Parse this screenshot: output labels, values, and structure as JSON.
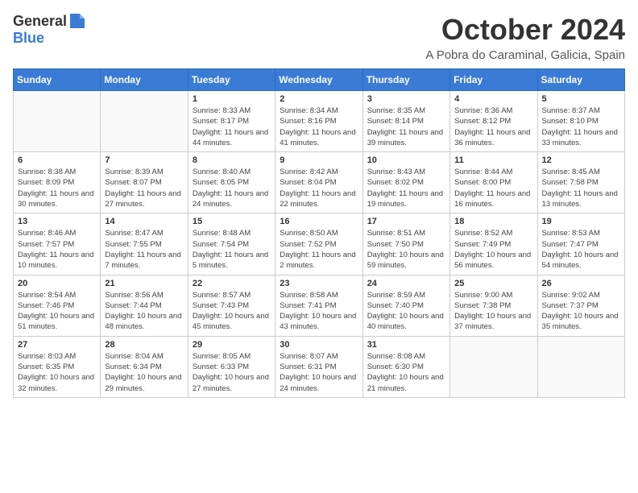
{
  "header": {
    "logo_general": "General",
    "logo_blue": "Blue",
    "title": "October 2024",
    "location": "A Pobra do Caraminal, Galicia, Spain"
  },
  "weekdays": [
    "Sunday",
    "Monday",
    "Tuesday",
    "Wednesday",
    "Thursday",
    "Friday",
    "Saturday"
  ],
  "weeks": [
    [
      {
        "day": "",
        "sunrise": "",
        "sunset": "",
        "daylight": ""
      },
      {
        "day": "",
        "sunrise": "",
        "sunset": "",
        "daylight": ""
      },
      {
        "day": "1",
        "sunrise": "Sunrise: 8:33 AM",
        "sunset": "Sunset: 8:17 PM",
        "daylight": "Daylight: 11 hours and 44 minutes."
      },
      {
        "day": "2",
        "sunrise": "Sunrise: 8:34 AM",
        "sunset": "Sunset: 8:16 PM",
        "daylight": "Daylight: 11 hours and 41 minutes."
      },
      {
        "day": "3",
        "sunrise": "Sunrise: 8:35 AM",
        "sunset": "Sunset: 8:14 PM",
        "daylight": "Daylight: 11 hours and 39 minutes."
      },
      {
        "day": "4",
        "sunrise": "Sunrise: 8:36 AM",
        "sunset": "Sunset: 8:12 PM",
        "daylight": "Daylight: 11 hours and 36 minutes."
      },
      {
        "day": "5",
        "sunrise": "Sunrise: 8:37 AM",
        "sunset": "Sunset: 8:10 PM",
        "daylight": "Daylight: 11 hours and 33 minutes."
      }
    ],
    [
      {
        "day": "6",
        "sunrise": "Sunrise: 8:38 AM",
        "sunset": "Sunset: 8:09 PM",
        "daylight": "Daylight: 11 hours and 30 minutes."
      },
      {
        "day": "7",
        "sunrise": "Sunrise: 8:39 AM",
        "sunset": "Sunset: 8:07 PM",
        "daylight": "Daylight: 11 hours and 27 minutes."
      },
      {
        "day": "8",
        "sunrise": "Sunrise: 8:40 AM",
        "sunset": "Sunset: 8:05 PM",
        "daylight": "Daylight: 11 hours and 24 minutes."
      },
      {
        "day": "9",
        "sunrise": "Sunrise: 8:42 AM",
        "sunset": "Sunset: 8:04 PM",
        "daylight": "Daylight: 11 hours and 22 minutes."
      },
      {
        "day": "10",
        "sunrise": "Sunrise: 8:43 AM",
        "sunset": "Sunset: 8:02 PM",
        "daylight": "Daylight: 11 hours and 19 minutes."
      },
      {
        "day": "11",
        "sunrise": "Sunrise: 8:44 AM",
        "sunset": "Sunset: 8:00 PM",
        "daylight": "Daylight: 11 hours and 16 minutes."
      },
      {
        "day": "12",
        "sunrise": "Sunrise: 8:45 AM",
        "sunset": "Sunset: 7:58 PM",
        "daylight": "Daylight: 11 hours and 13 minutes."
      }
    ],
    [
      {
        "day": "13",
        "sunrise": "Sunrise: 8:46 AM",
        "sunset": "Sunset: 7:57 PM",
        "daylight": "Daylight: 11 hours and 10 minutes."
      },
      {
        "day": "14",
        "sunrise": "Sunrise: 8:47 AM",
        "sunset": "Sunset: 7:55 PM",
        "daylight": "Daylight: 11 hours and 7 minutes."
      },
      {
        "day": "15",
        "sunrise": "Sunrise: 8:48 AM",
        "sunset": "Sunset: 7:54 PM",
        "daylight": "Daylight: 11 hours and 5 minutes."
      },
      {
        "day": "16",
        "sunrise": "Sunrise: 8:50 AM",
        "sunset": "Sunset: 7:52 PM",
        "daylight": "Daylight: 11 hours and 2 minutes."
      },
      {
        "day": "17",
        "sunrise": "Sunrise: 8:51 AM",
        "sunset": "Sunset: 7:50 PM",
        "daylight": "Daylight: 10 hours and 59 minutes."
      },
      {
        "day": "18",
        "sunrise": "Sunrise: 8:52 AM",
        "sunset": "Sunset: 7:49 PM",
        "daylight": "Daylight: 10 hours and 56 minutes."
      },
      {
        "day": "19",
        "sunrise": "Sunrise: 8:53 AM",
        "sunset": "Sunset: 7:47 PM",
        "daylight": "Daylight: 10 hours and 54 minutes."
      }
    ],
    [
      {
        "day": "20",
        "sunrise": "Sunrise: 8:54 AM",
        "sunset": "Sunset: 7:46 PM",
        "daylight": "Daylight: 10 hours and 51 minutes."
      },
      {
        "day": "21",
        "sunrise": "Sunrise: 8:56 AM",
        "sunset": "Sunset: 7:44 PM",
        "daylight": "Daylight: 10 hours and 48 minutes."
      },
      {
        "day": "22",
        "sunrise": "Sunrise: 8:57 AM",
        "sunset": "Sunset: 7:43 PM",
        "daylight": "Daylight: 10 hours and 45 minutes."
      },
      {
        "day": "23",
        "sunrise": "Sunrise: 8:58 AM",
        "sunset": "Sunset: 7:41 PM",
        "daylight": "Daylight: 10 hours and 43 minutes."
      },
      {
        "day": "24",
        "sunrise": "Sunrise: 8:59 AM",
        "sunset": "Sunset: 7:40 PM",
        "daylight": "Daylight: 10 hours and 40 minutes."
      },
      {
        "day": "25",
        "sunrise": "Sunrise: 9:00 AM",
        "sunset": "Sunset: 7:38 PM",
        "daylight": "Daylight: 10 hours and 37 minutes."
      },
      {
        "day": "26",
        "sunrise": "Sunrise: 9:02 AM",
        "sunset": "Sunset: 7:37 PM",
        "daylight": "Daylight: 10 hours and 35 minutes."
      }
    ],
    [
      {
        "day": "27",
        "sunrise": "Sunrise: 8:03 AM",
        "sunset": "Sunset: 6:35 PM",
        "daylight": "Daylight: 10 hours and 32 minutes."
      },
      {
        "day": "28",
        "sunrise": "Sunrise: 8:04 AM",
        "sunset": "Sunset: 6:34 PM",
        "daylight": "Daylight: 10 hours and 29 minutes."
      },
      {
        "day": "29",
        "sunrise": "Sunrise: 8:05 AM",
        "sunset": "Sunset: 6:33 PM",
        "daylight": "Daylight: 10 hours and 27 minutes."
      },
      {
        "day": "30",
        "sunrise": "Sunrise: 8:07 AM",
        "sunset": "Sunset: 6:31 PM",
        "daylight": "Daylight: 10 hours and 24 minutes."
      },
      {
        "day": "31",
        "sunrise": "Sunrise: 8:08 AM",
        "sunset": "Sunset: 6:30 PM",
        "daylight": "Daylight: 10 hours and 21 minutes."
      },
      {
        "day": "",
        "sunrise": "",
        "sunset": "",
        "daylight": ""
      },
      {
        "day": "",
        "sunrise": "",
        "sunset": "",
        "daylight": ""
      }
    ]
  ]
}
